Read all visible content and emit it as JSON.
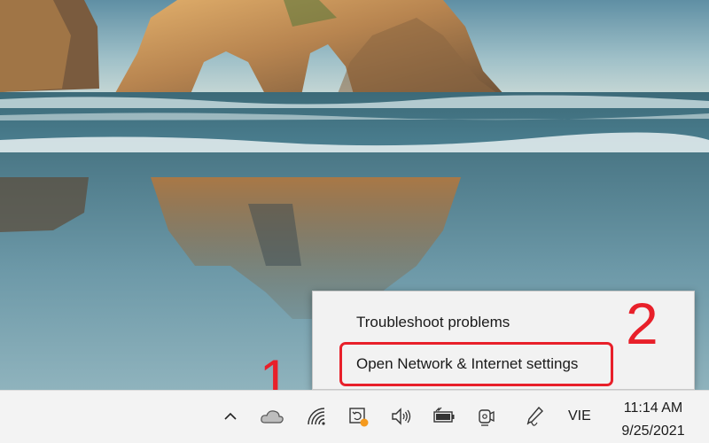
{
  "desktop": {
    "wallpaper": "beach-sea-arch-landscape"
  },
  "context_menu": {
    "items": [
      {
        "label": "Troubleshoot problems"
      },
      {
        "label": "Open Network & Internet settings"
      }
    ]
  },
  "annotations": {
    "step_1": "1",
    "step_2": "2",
    "color": "#e8202a"
  },
  "taskbar": {
    "tray_icons": [
      {
        "icon": "chevron-up-icon"
      },
      {
        "icon": "onedrive-cloud-icon"
      },
      {
        "icon": "wifi-icon"
      },
      {
        "icon": "sync-app-icon",
        "badge_color": "#f59a1d"
      },
      {
        "icon": "volume-icon"
      },
      {
        "icon": "battery-icon"
      },
      {
        "icon": "camera-icon"
      },
      {
        "icon": "pen-icon"
      }
    ],
    "language": "VIE",
    "time": "11:14 AM",
    "date": "9/25/2021"
  }
}
